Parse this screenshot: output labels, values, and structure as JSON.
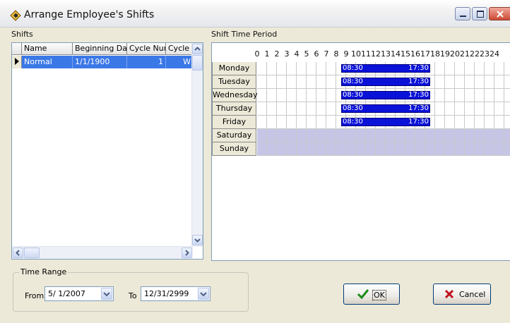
{
  "window": {
    "title": "Arrange Employee's Shifts"
  },
  "shifts_panel": {
    "label": "Shifts",
    "columns": [
      "Name",
      "Beginning Date",
      "Cycle Num",
      "Cycle"
    ],
    "rows": [
      {
        "name": "Normal",
        "beginning_date": "1/1/1900",
        "cycle_num": "1",
        "cycle": "W"
      }
    ]
  },
  "shift_time_panel": {
    "label": "Shift Time Period",
    "hours": [
      "0",
      "1",
      "2",
      "3",
      "4",
      "5",
      "6",
      "7",
      "8",
      "9",
      "10",
      "11",
      "12",
      "13",
      "14",
      "15",
      "16",
      "17",
      "18",
      "19",
      "20",
      "21",
      "22",
      "23",
      "24"
    ],
    "days": [
      {
        "name": "Monday",
        "start": "08:30",
        "end": "17:30",
        "weekend": false
      },
      {
        "name": "Tuesday",
        "start": "08:30",
        "end": "17:30",
        "weekend": false
      },
      {
        "name": "Wednesday",
        "start": "08:30",
        "end": "17:30",
        "weekend": false
      },
      {
        "name": "Thursday",
        "start": "08:30",
        "end": "17:30",
        "weekend": false
      },
      {
        "name": "Friday",
        "start": "08:30",
        "end": "17:30",
        "weekend": false
      },
      {
        "name": "Saturday",
        "start": "",
        "end": "",
        "weekend": true
      },
      {
        "name": "Sunday",
        "start": "",
        "end": "",
        "weekend": true
      }
    ]
  },
  "time_range": {
    "label": "Time Range",
    "from_label": "From",
    "from_value": "5/ 1/2007",
    "to_label": "To",
    "to_value": "12/31/2999"
  },
  "buttons": {
    "ok": "OK",
    "cancel": "Cancel"
  },
  "colors": {
    "shift_bar": "#0b12d8",
    "weekend": "#c6c5e6",
    "selection": "#3b78e7",
    "dialog_bg": "#ece9d8"
  }
}
